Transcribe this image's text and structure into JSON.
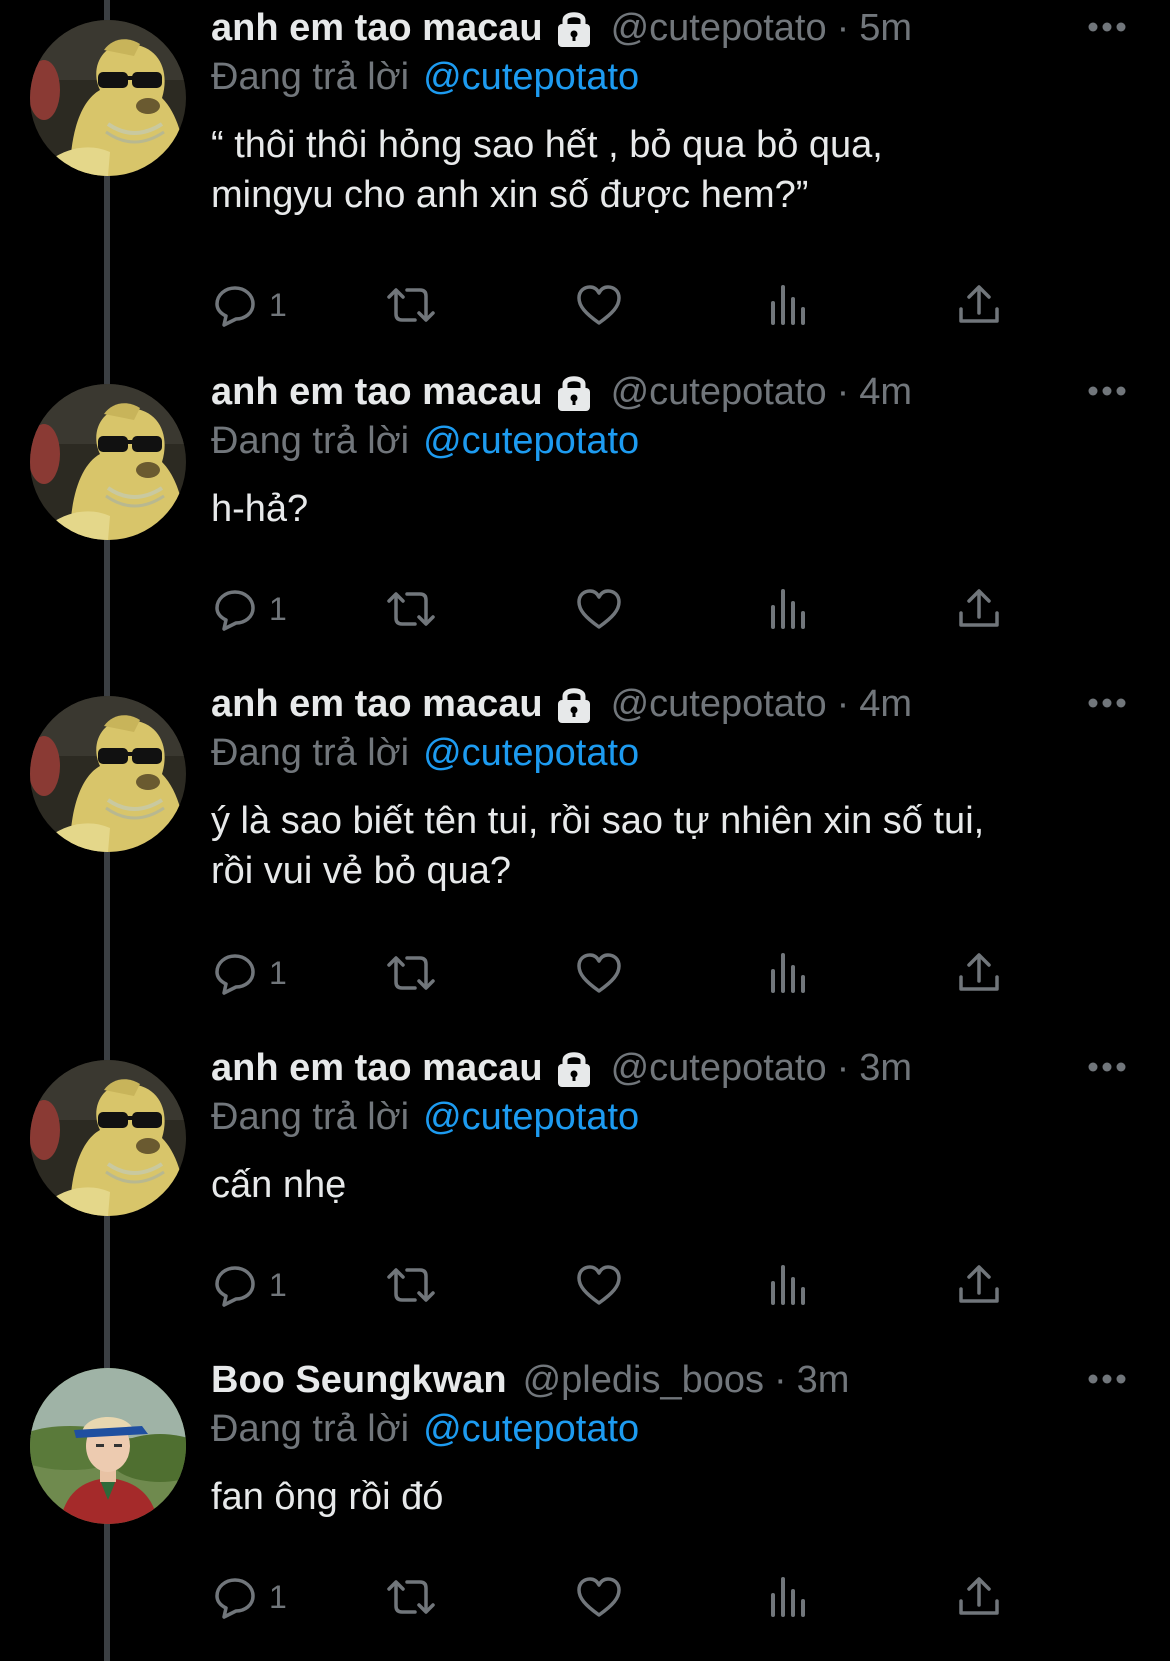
{
  "thread": {
    "tweets": [
      {
        "name": "anh em tao macau",
        "locked": true,
        "handle": "@cutepotato",
        "separator": "·",
        "time": "5m",
        "reply_prefix": "Đang trả lời",
        "reply_to": "@cutepotato",
        "text": "“ thôi thôi hỏng sao hết , bỏ qua bỏ qua,\nmingyu cho anh xin số được hem?”",
        "reply_count": "1",
        "avatar": "dog-with-sunglasses"
      },
      {
        "name": "anh em tao macau",
        "locked": true,
        "handle": "@cutepotato",
        "separator": "·",
        "time": "4m",
        "reply_prefix": "Đang trả lời",
        "reply_to": "@cutepotato",
        "text": "h-hả?",
        "reply_count": "1",
        "avatar": "dog-with-sunglasses"
      },
      {
        "name": "anh em tao macau",
        "locked": true,
        "handle": "@cutepotato",
        "separator": "·",
        "time": "4m",
        "reply_prefix": "Đang trả lời",
        "reply_to": "@cutepotato",
        "text": "ý là sao biết tên tui, rồi sao tự nhiên xin số tui,\nrồi vui vẻ bỏ qua?",
        "reply_count": "1",
        "avatar": "dog-with-sunglasses"
      },
      {
        "name": "anh em tao macau",
        "locked": true,
        "handle": "@cutepotato",
        "separator": "·",
        "time": "3m",
        "reply_prefix": "Đang trả lời",
        "reply_to": "@cutepotato",
        "text": "cấn nhẹ",
        "reply_count": "1",
        "avatar": "dog-with-sunglasses"
      },
      {
        "name": "Boo Seungkwan",
        "locked": false,
        "handle": "@pledis_boos",
        "separator": "·",
        "time": "3m",
        "reply_prefix": "Đang trả lời",
        "reply_to": "@cutepotato",
        "text": "fan ông rồi đó",
        "reply_count": "1",
        "avatar": "person-with-visor"
      }
    ]
  },
  "icons": {
    "reply": "reply-icon",
    "retweet": "retweet-icon",
    "like": "like-icon",
    "views": "views-icon",
    "share": "share-icon",
    "more": "more-icon",
    "lock": "lock-icon"
  },
  "colors": {
    "background": "#000000",
    "text": "#e7e9ea",
    "muted": "#71767b",
    "accent": "#1d9bf0",
    "thread_line": "#3b3f43"
  }
}
